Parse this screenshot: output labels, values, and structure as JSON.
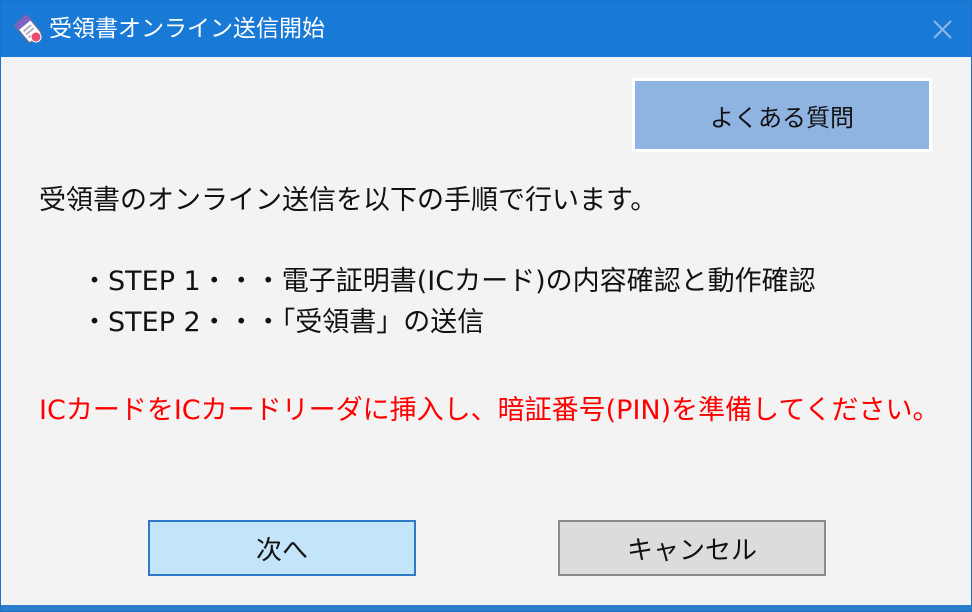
{
  "window": {
    "title": "受領書オンライン送信開始",
    "icons": {
      "app": "signed-document-icon",
      "close": "close-icon"
    },
    "colors": {
      "titlebar": "#1979d6",
      "background": "#f3f3f3",
      "warning_text": "#ff0000",
      "faq_button": "#8fb4e2",
      "next_button": "#c4e4fa",
      "cancel_button": "#dcdcdc"
    }
  },
  "toolbar": {
    "faq_label": "よくある質問"
  },
  "content": {
    "intro": "受領書のオンライン送信を以下の手順で行います。",
    "steps": [
      "・STEP 1・・・電子証明書(ICカード)の内容確認と動作確認",
      "・STEP 2・・・「受領書」の送信"
    ],
    "warning": "ICカードをICカードリーダに挿入し、暗証番号(PIN)を準備してください。"
  },
  "buttons": {
    "next_label": "次へ",
    "cancel_label": "キャンセル"
  }
}
